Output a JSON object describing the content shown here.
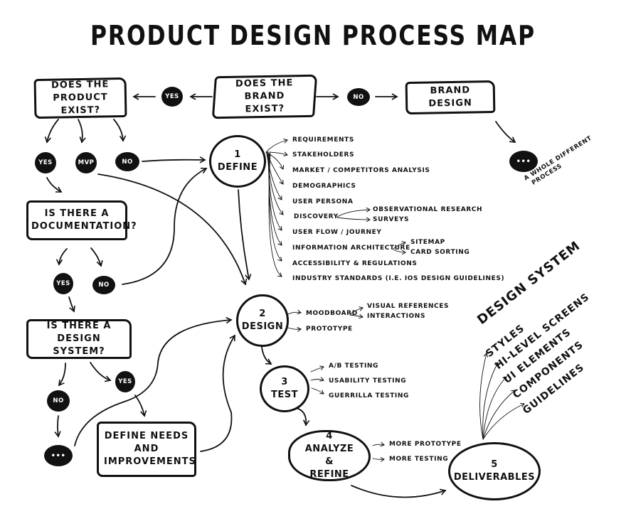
{
  "title": "PRODUCT DESIGN PROCESS MAP",
  "decisions": {
    "brand_exist": "DOES THE BRAND EXIST?",
    "product_exist": "DOES THE PRODUCT EXIST?",
    "documentation": "IS THERE A DOCUMENTATION?",
    "design_system": "IS THERE A DESIGN SYSTEM?"
  },
  "boxes": {
    "brand_design": "BRAND DESIGN",
    "define_needs": "DEFINE NEEDS AND IMPROVEMENTS"
  },
  "badges": {
    "brand_yes": "YES",
    "brand_no": "NO",
    "product_yes": "YES",
    "product_mvp": "MVP",
    "product_no": "NO",
    "doc_yes": "YES",
    "doc_no": "NO",
    "ds_no": "NO",
    "ds_yes": "YES",
    "ellipsis_brand": "•••",
    "ellipsis_ds": "•••"
  },
  "annotations": {
    "whole_different_line1": "A WHOLE DIFFERENT",
    "whole_different_line2": "PROCESS"
  },
  "stages": [
    {
      "number": "1",
      "label": "DEFINE"
    },
    {
      "number": "2",
      "label": "DESIGN"
    },
    {
      "number": "3",
      "label": "TEST"
    },
    {
      "number": "4",
      "label": "ANALYZE & REFINE"
    },
    {
      "number": "5",
      "label": "DELIVERABLES"
    }
  ],
  "define_items": [
    "REQUIREMENTS",
    "STAKEHOLDERS",
    "MARKET / COMPETITORS ANALYSIS",
    "DEMOGRAPHICS",
    "USER PERSONA",
    "DISCOVERY",
    "USER FLOW / JOURNEY",
    "INFORMATION ARCHITECTURE",
    "ACCESSIBILITY & REGULATIONS",
    "INDUSTRY STANDARDS (I.E. IOS DESIGN GUIDELINES)"
  ],
  "discovery_sub": [
    "OBSERVATIONAL RESEARCH",
    "SURVEYS"
  ],
  "ia_sub": [
    "SITEMAP",
    "CARD SORTING"
  ],
  "design_items": [
    "MOODBOARD",
    "PROTOTYPE"
  ],
  "moodboard_sub": [
    "VISUAL REFERENCES",
    "INTERACTIONS"
  ],
  "test_items": [
    "A/B TESTING",
    "USABILITY TESTING",
    "GUERRILLA TESTING"
  ],
  "analyze_items": [
    "MORE PROTOTYPE",
    "MORE TESTING"
  ],
  "design_system": {
    "heading": "DESIGN SYSTEM",
    "items": [
      "STYLES",
      "HI-LEVEL SCREENS",
      "UI ELEMENTS",
      "COMPONENTS",
      "GUIDELINES"
    ]
  }
}
